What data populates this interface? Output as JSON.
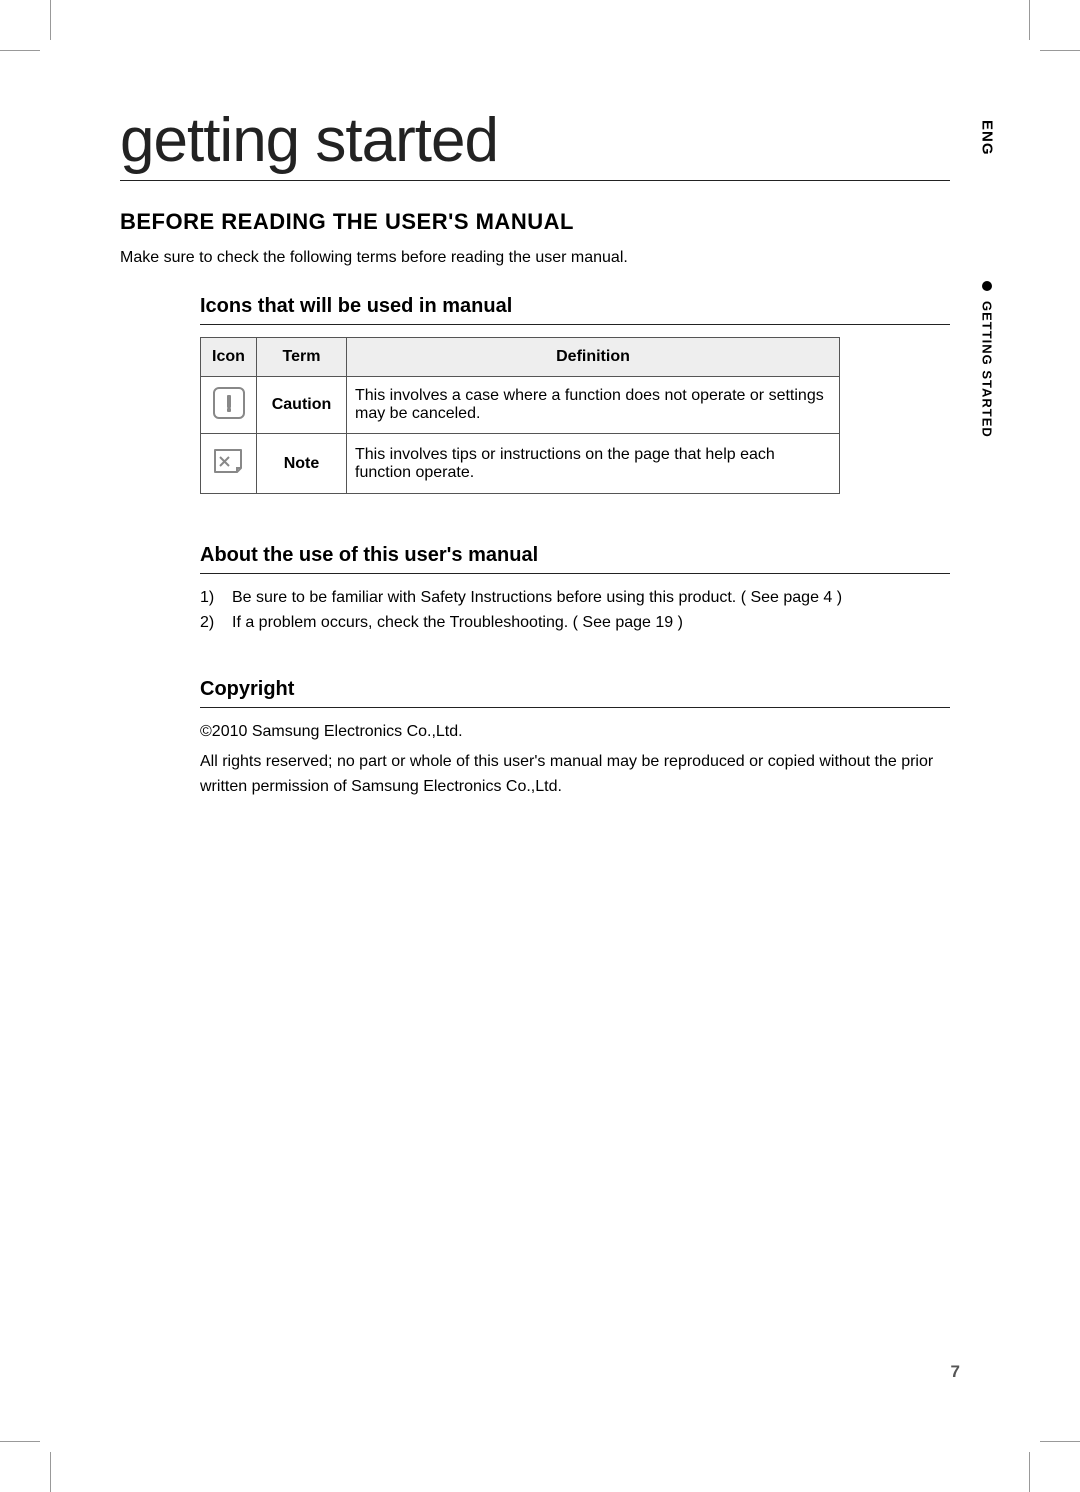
{
  "side": {
    "lang": "ENG",
    "tab": "GETTING STARTED"
  },
  "h1": "getting started",
  "h2": "BEFORE READING THE USER'S MANUAL",
  "intro": "Make sure to check the following terms before reading the user manual.",
  "section_icons": {
    "heading": "Icons that will be used in manual",
    "headers": {
      "icon": "Icon",
      "term": "Term",
      "definition": "Definition"
    },
    "rows": [
      {
        "term": "Caution",
        "definition": "This involves a case where a function does not operate or settings may be canceled."
      },
      {
        "term": "Note",
        "definition": "This involves tips or instructions on the page that help each function operate."
      }
    ]
  },
  "section_about": {
    "heading": "About the use of this user's manual",
    "items": [
      {
        "num": "1)",
        "text": "Be sure to be familiar with Safety Instructions before using this product. ( See page 4 )"
      },
      {
        "num": "2)",
        "text": "If a problem occurs, check the Troubleshooting. ( See page 19 )"
      }
    ]
  },
  "section_copyright": {
    "heading": "Copyright",
    "line1": "©2010 Samsung Electronics Co.,Ltd.",
    "line2": "All rights reserved; no part or whole of this user's manual may be reproduced or copied without the prior written permission of Samsung Electronics Co.,Ltd."
  },
  "page_number": "7"
}
